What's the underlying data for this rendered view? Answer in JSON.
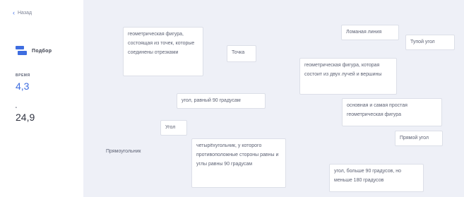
{
  "sidebar": {
    "back_label": "Назад",
    "mode_label": "Подбор",
    "stats": [
      {
        "label": "ВРЕМЯ",
        "value": "4,3"
      },
      {
        "label": "•",
        "value": "24,9"
      }
    ]
  },
  "cards": [
    {
      "text": "геометрическая фигура, состоящая из точек, которые соединены отрезками"
    },
    {
      "text": "Точка"
    },
    {
      "text": "Ломаная линия"
    },
    {
      "text": "Тупой угол"
    },
    {
      "text": "геометрическая фигура, которая состоит из двух лучей и вершины"
    },
    {
      "text": "угол, равный 90 градусам"
    },
    {
      "text": "основная и самая простая геометрическая фигура"
    },
    {
      "text": "Угол"
    },
    {
      "text": "Прямой угол"
    },
    {
      "text": "Прямоугольник"
    },
    {
      "text": "четырёхугольник, у которого противоположные стороны равны и углы равны 90 градусам"
    },
    {
      "text": "угол, больше 90 градусов, но меньше 180 градусов"
    }
  ]
}
